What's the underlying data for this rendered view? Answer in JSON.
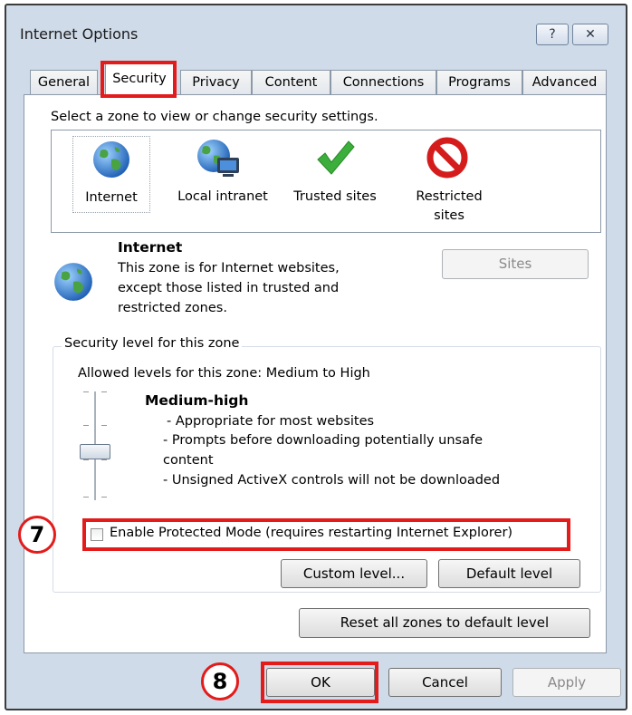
{
  "window": {
    "title": "Internet Options",
    "help_glyph": "?",
    "close_glyph": "✕"
  },
  "tabs": [
    {
      "label": "General"
    },
    {
      "label": "Security"
    },
    {
      "label": "Privacy"
    },
    {
      "label": "Content"
    },
    {
      "label": "Connections"
    },
    {
      "label": "Programs"
    },
    {
      "label": "Advanced"
    }
  ],
  "security": {
    "instruction": "Select a zone to view or change security settings.",
    "zones": [
      {
        "label": "Internet",
        "icon": "globe-icon"
      },
      {
        "label": "Local intranet",
        "icon": "intranet-globe-icon"
      },
      {
        "label": "Trusted sites",
        "icon": "checkmark-icon"
      },
      {
        "label_line1": "Restricted",
        "label_line2": "sites",
        "icon": "no-entry-icon"
      }
    ],
    "selected_zone": {
      "name": "Internet",
      "desc_line1": "This zone is for Internet websites,",
      "desc_line2": "except those listed in trusted and",
      "desc_line3": "restricted zones."
    },
    "sites_button": "Sites",
    "level_group_label": "Security level for this zone",
    "allowed_levels": "Allowed levels for this zone: Medium to High",
    "level_name": "Medium-high",
    "level_desc_1": "- Appropriate for most websites",
    "level_desc_2": "- Prompts before downloading potentially unsafe",
    "level_desc_2b": "content",
    "level_desc_3": "- Unsigned ActiveX controls will not be downloaded",
    "protected_mode_label": "Enable Protected Mode (requires restarting Internet Explorer)",
    "protected_mode_checked": false,
    "custom_level_button": "Custom level...",
    "default_level_button": "Default level",
    "reset_all_button": "Reset all zones to default level"
  },
  "footer": {
    "ok": "OK",
    "cancel": "Cancel",
    "apply": "Apply"
  },
  "annotations": {
    "step_7": "7",
    "step_8": "8",
    "color": "#e31b1b"
  }
}
